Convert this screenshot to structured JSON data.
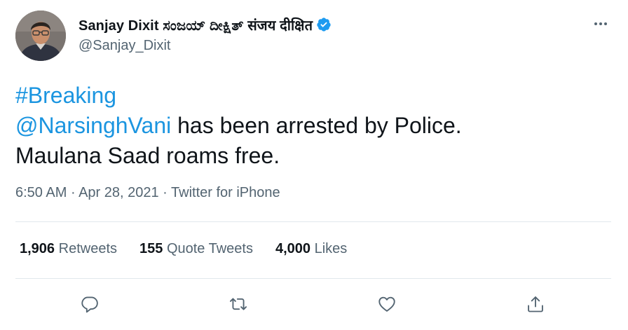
{
  "author": {
    "display_name": "Sanjay Dixit ಸಂಜಯ್ ದೀಕ್ಷಿತ್ संजय दीक्षित",
    "handle": "@Sanjay_Dixit",
    "verified": true
  },
  "tweet": {
    "hashtag": "#Breaking",
    "mention": "@NarsinghVani",
    "text_after_mention": " has been arrested by Police.",
    "line3": "Maulana Saad roams free."
  },
  "meta": {
    "time": "6:50 AM",
    "date": "Apr 28, 2021",
    "source": "Twitter for iPhone",
    "separator": " · "
  },
  "stats": {
    "retweets": {
      "count": "1,906",
      "label": "Retweets"
    },
    "quote_tweets": {
      "count": "155",
      "label": "Quote Tweets"
    },
    "likes": {
      "count": "4,000",
      "label": "Likes"
    }
  },
  "icons": {
    "reply": "reply-icon",
    "retweet": "retweet-icon",
    "like": "heart-icon",
    "share": "share-icon",
    "more": "more-icon",
    "verified": "verified-badge-icon"
  },
  "colors": {
    "text": "#0f1419",
    "secondary": "#536471",
    "link": "#1b95e0",
    "verified": "#1d9bf0",
    "divider": "#e1e8ed"
  }
}
